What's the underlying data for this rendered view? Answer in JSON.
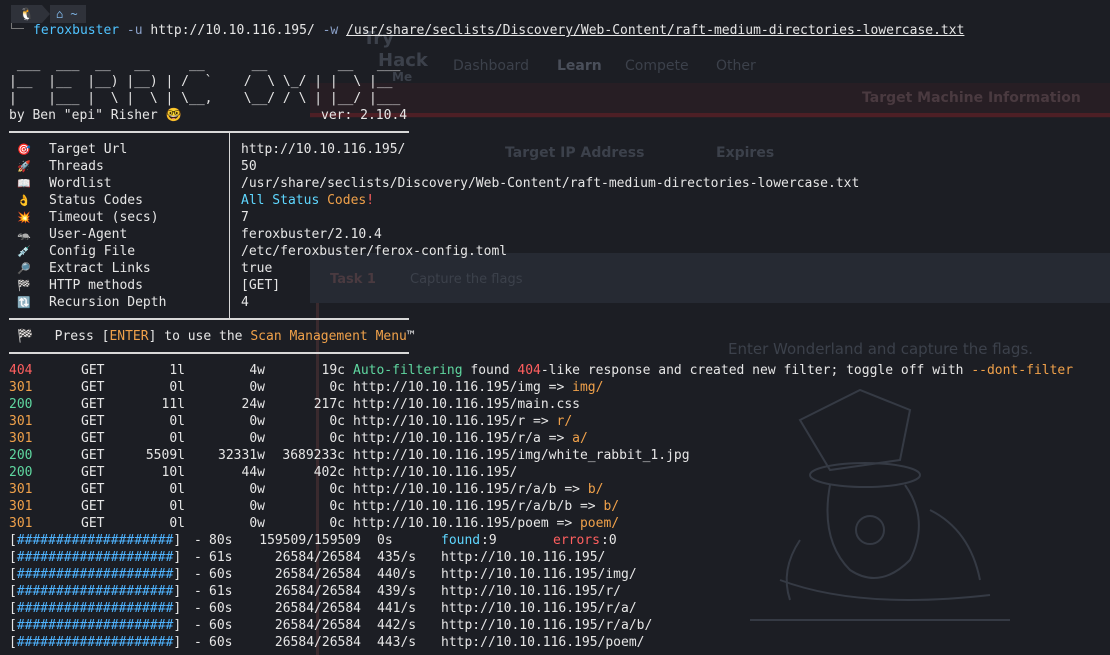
{
  "prompt": {
    "os_icon": "🐧",
    "home_icon": "⌂",
    "cwd": "~"
  },
  "command": {
    "program": "feroxbuster",
    "flag_u": "-u",
    "url": "http://10.10.116.195/",
    "flag_w": "-w",
    "wordlist": "/usr/share/seclists/Discovery/Web-Content/raft-medium-directories-lowercase.txt"
  },
  "banner": {
    "art": [
      " ___  ___  __   __     __      __         __   ___",
      "|__  |__  |__) |__) | /  `    /  \\ \\_/ | |  \\ |__",
      "|    |___ |  \\ |  \\ | \\__,    \\__/ / \\ | |__/ |___"
    ],
    "author": "by Ben \"epi\" Risher 🤓",
    "version": "ver: 2.10.4"
  },
  "config": [
    {
      "icon": "🎯",
      "label": "Target Url",
      "value": "http://10.10.116.195/"
    },
    {
      "icon": "🚀",
      "label": "Threads",
      "value": "50"
    },
    {
      "icon": "📖",
      "label": "Wordlist",
      "value": "/usr/share/seclists/Discovery/Web-Content/raft-medium-directories-lowercase.txt"
    },
    {
      "icon": "👌",
      "label": "Status Codes",
      "value_a": "All Status",
      "value_b": "Codes",
      "value_c": "!"
    },
    {
      "icon": "💥",
      "label": "Timeout (secs)",
      "value": "7"
    },
    {
      "icon": "🦡",
      "label": "User-Agent",
      "value": "feroxbuster/2.10.4"
    },
    {
      "icon": "💉",
      "label": "Config File",
      "value": "/etc/feroxbuster/ferox-config.toml"
    },
    {
      "icon": "🔎",
      "label": "Extract Links",
      "value": "true"
    },
    {
      "icon": "🏁",
      "label": "HTTP methods",
      "value": "[GET]"
    },
    {
      "icon": "🔃",
      "label": "Recursion Depth",
      "value": "4"
    }
  ],
  "menu_hint": {
    "icon": "🏁",
    "pre": "Press [",
    "key": "ENTER",
    "mid": "] to use the ",
    "menu": "Scan Management Menu",
    "post": "™"
  },
  "results": [
    {
      "code": "404",
      "method": "GET",
      "lines": "1l",
      "words": "4w",
      "chars": "19c",
      "msg_a": "Auto-filtering",
      "msg_b": " found ",
      "msg_c": "404",
      "msg_d": "-like response and created new filter; toggle off with ",
      "msg_e": "--dont-filter"
    },
    {
      "code": "301",
      "method": "GET",
      "lines": "0l",
      "words": "0w",
      "chars": "0c",
      "url": "http://10.10.116.195/img => ",
      "redirect": "img/"
    },
    {
      "code": "200",
      "method": "GET",
      "lines": "11l",
      "words": "24w",
      "chars": "217c",
      "url": "http://10.10.116.195/main.css"
    },
    {
      "code": "301",
      "method": "GET",
      "lines": "0l",
      "words": "0w",
      "chars": "0c",
      "url": "http://10.10.116.195/r => ",
      "redirect": "r/"
    },
    {
      "code": "301",
      "method": "GET",
      "lines": "0l",
      "words": "0w",
      "chars": "0c",
      "url": "http://10.10.116.195/r/a => ",
      "redirect": "a/"
    },
    {
      "code": "200",
      "method": "GET",
      "lines": "5509l",
      "words": "32331w",
      "chars": "3689233c",
      "url": "http://10.10.116.195/img/white_rabbit_1.jpg"
    },
    {
      "code": "200",
      "method": "GET",
      "lines": "10l",
      "words": "44w",
      "chars": "402c",
      "url": "http://10.10.116.195/"
    },
    {
      "code": "301",
      "method": "GET",
      "lines": "0l",
      "words": "0w",
      "chars": "0c",
      "url": "http://10.10.116.195/r/a/b => ",
      "redirect": "b/"
    },
    {
      "code": "301",
      "method": "GET",
      "lines": "0l",
      "words": "0w",
      "chars": "0c",
      "url": "http://10.10.116.195/r/a/b/b => ",
      "redirect": "b/"
    },
    {
      "code": "301",
      "method": "GET",
      "lines": "0l",
      "words": "0w",
      "chars": "0c",
      "url": "http://10.10.116.195/poem => ",
      "redirect": "poem/"
    }
  ],
  "progress": [
    {
      "bar": "####################",
      "time": "80s",
      "count": "159509/159509",
      "rate": "0s",
      "found_label": "found",
      "found": "9",
      "errors_label": "errors",
      "errors": "0",
      "fraction": 1.0
    },
    {
      "bar": "####################",
      "time": "61s",
      "count": "26584/26584",
      "rate": "435/s",
      "url": "http://10.10.116.195/",
      "fraction": 1.0
    },
    {
      "bar": "####################",
      "time": "60s",
      "count": "26584/26584",
      "rate": "440/s",
      "url": "http://10.10.116.195/img/",
      "fraction": 1.0
    },
    {
      "bar": "####################",
      "time": "61s",
      "count": "26584/26584",
      "rate": "439/s",
      "url": "http://10.10.116.195/r/",
      "fraction": 1.0
    },
    {
      "bar": "####################",
      "time": "60s",
      "count": "26584/26584",
      "rate": "441/s",
      "url": "http://10.10.116.195/r/a/",
      "fraction": 1.0
    },
    {
      "bar": "####################",
      "time": "60s",
      "count": "26584/26584",
      "rate": "442/s",
      "url": "http://10.10.116.195/r/a/b/",
      "fraction": 1.0
    },
    {
      "bar": "####################",
      "time": "60s",
      "count": "26584/26584",
      "rate": "443/s",
      "url": "http://10.10.116.195/poem/",
      "fraction": 1.0
    }
  ],
  "background_page": {
    "brand_a": "Try",
    "brand_b": "Hack",
    "brand_c": "Me",
    "nav": [
      "Dashboard",
      "Learn",
      "Compete",
      "Other"
    ],
    "section_title": "Target Machine Information",
    "col_ip": "Target IP Address",
    "col_expires": "Expires",
    "task_label": "Task 1",
    "task_title": "Capture the flags",
    "task_desc": "Enter Wonderland and capture the flags."
  },
  "colors": {
    "bg": "#1c1e24",
    "ok": "#5fd7a0",
    "redirect": "#f0a14a",
    "error": "#ff5f5f",
    "accent": "#4fc3ff"
  }
}
